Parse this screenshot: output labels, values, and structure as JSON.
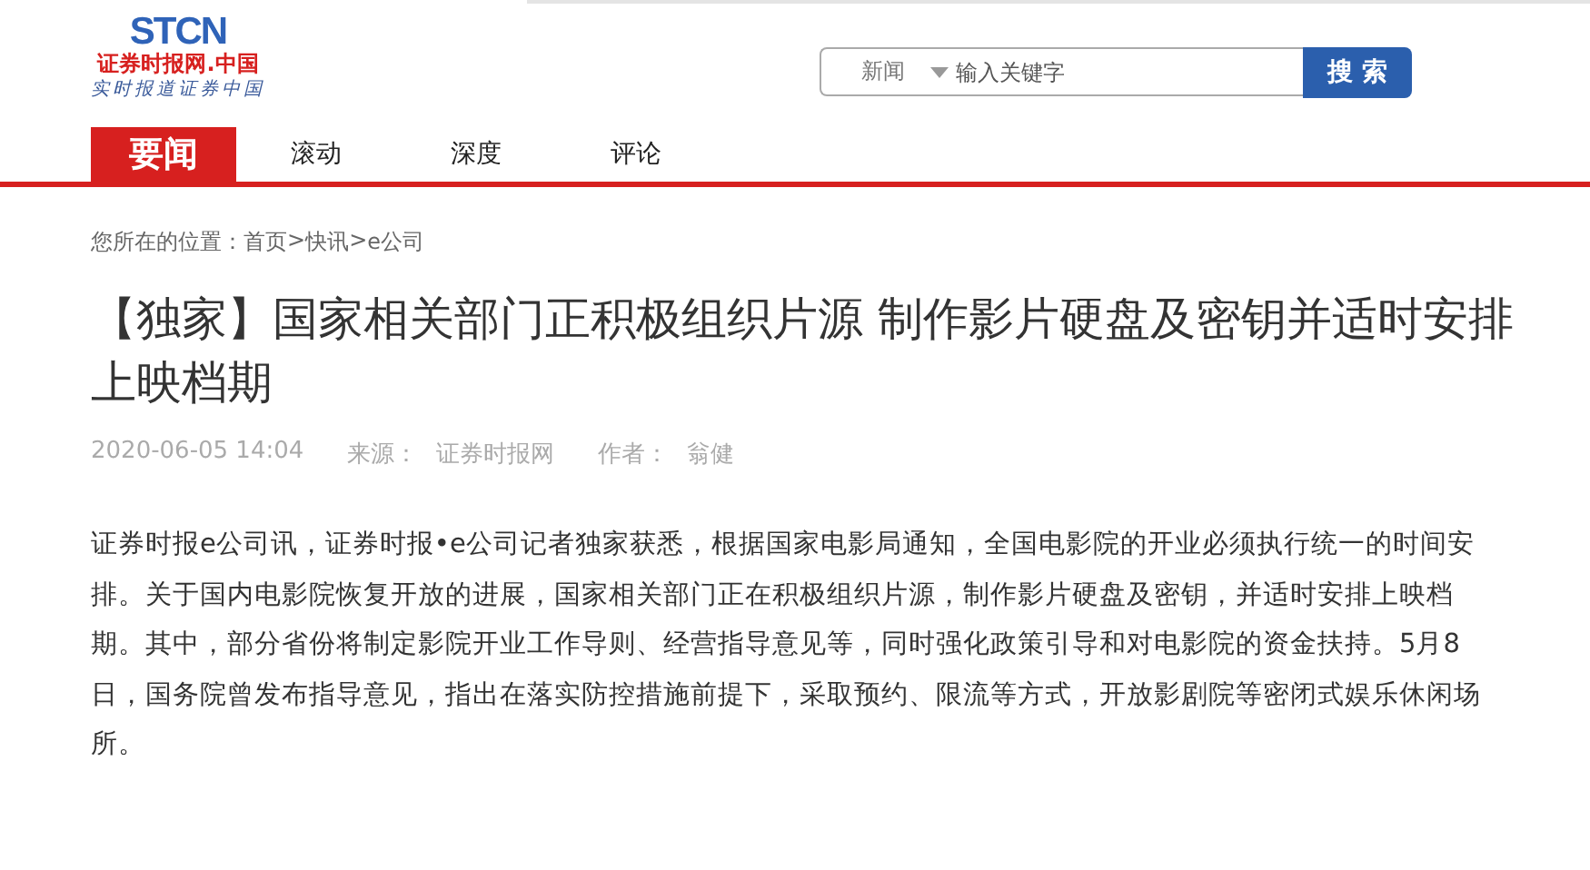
{
  "logo": {
    "brand": "STCN",
    "name": "证券时报网.中国",
    "slogan": "实时报道证券中国"
  },
  "search": {
    "scope": "新闻",
    "placeholder": "输入关键字",
    "button": "搜 索"
  },
  "nav": [
    {
      "label": "要闻",
      "selected": true
    },
    {
      "label": "滚动",
      "selected": false
    },
    {
      "label": "深度",
      "selected": false
    },
    {
      "label": "评论",
      "selected": false
    }
  ],
  "breadcrumb": {
    "label": "您所在的位置：",
    "items": [
      "首页",
      ">",
      "快讯",
      ">",
      "e公司"
    ]
  },
  "article": {
    "title": "【独家】国家相关部门正积极组织片源 制作影片硬盘及密钥并适时安排上映档期",
    "date": "2020-06-05 14:04",
    "source_label": "来源：",
    "source": "证券时报网",
    "author_label": "作者：",
    "author": "翁健",
    "body": "证券时报e公司讯，证券时报•e公司记者独家获悉，根据国家电影局通知，全国电影院的开业必须执行统一的时间安排。关于国内电影院恢复开放的进展，国家相关部门正在积极组织片源，制作影片硬盘及密钥，并适时安排上映档期。其中，部分省份将制定影院开业工作导则、经营指导意见等，同时强化政策引导和对电影院的资金扶持。5月8日，国务院曾发布指导意见，指出在落实防控措施前提下，采取预约、限流等方式，开放影剧院等密闭式娱乐休闲场所。"
  }
}
